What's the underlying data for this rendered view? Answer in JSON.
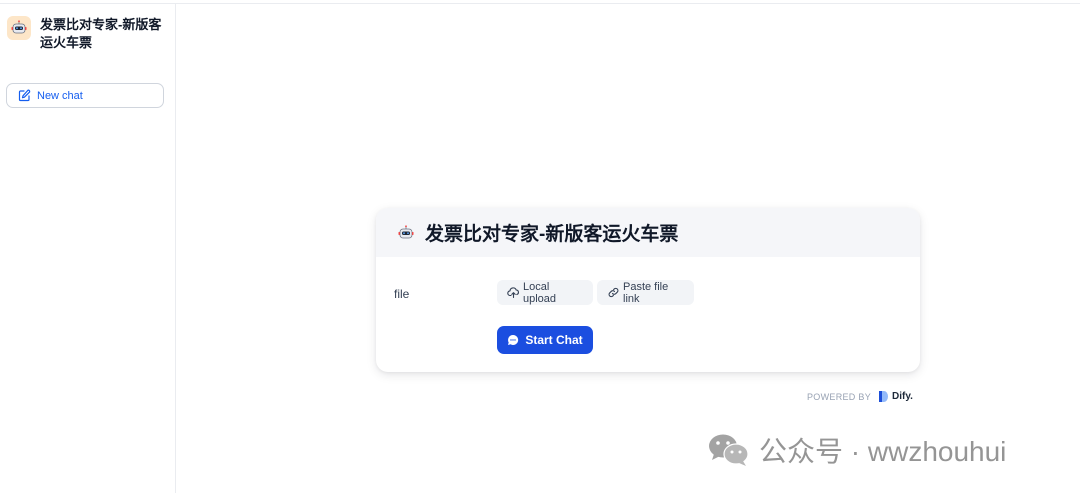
{
  "app": {
    "title": "发票比对专家-新版客运火车票"
  },
  "sidebar": {
    "new_chat_label": "New chat"
  },
  "card": {
    "title": "发票比对专家-新版客运火车票",
    "field_label": "file",
    "local_upload_label": "Local upload",
    "paste_link_label": "Paste file link",
    "start_label": "Start Chat"
  },
  "footer": {
    "powered_by": "POWERED BY",
    "brand": "Dify."
  },
  "watermark": {
    "text": "公众号 · wwzhouhui"
  },
  "colors": {
    "accent": "#1b4ee0",
    "link": "#155eef",
    "icon_bg": "#fde6c8"
  },
  "icons": [
    "robot-icon",
    "edit-icon",
    "cloud-upload-icon",
    "link-icon",
    "chat-bubble-icon",
    "dify-logo-icon",
    "wechat-icon"
  ]
}
